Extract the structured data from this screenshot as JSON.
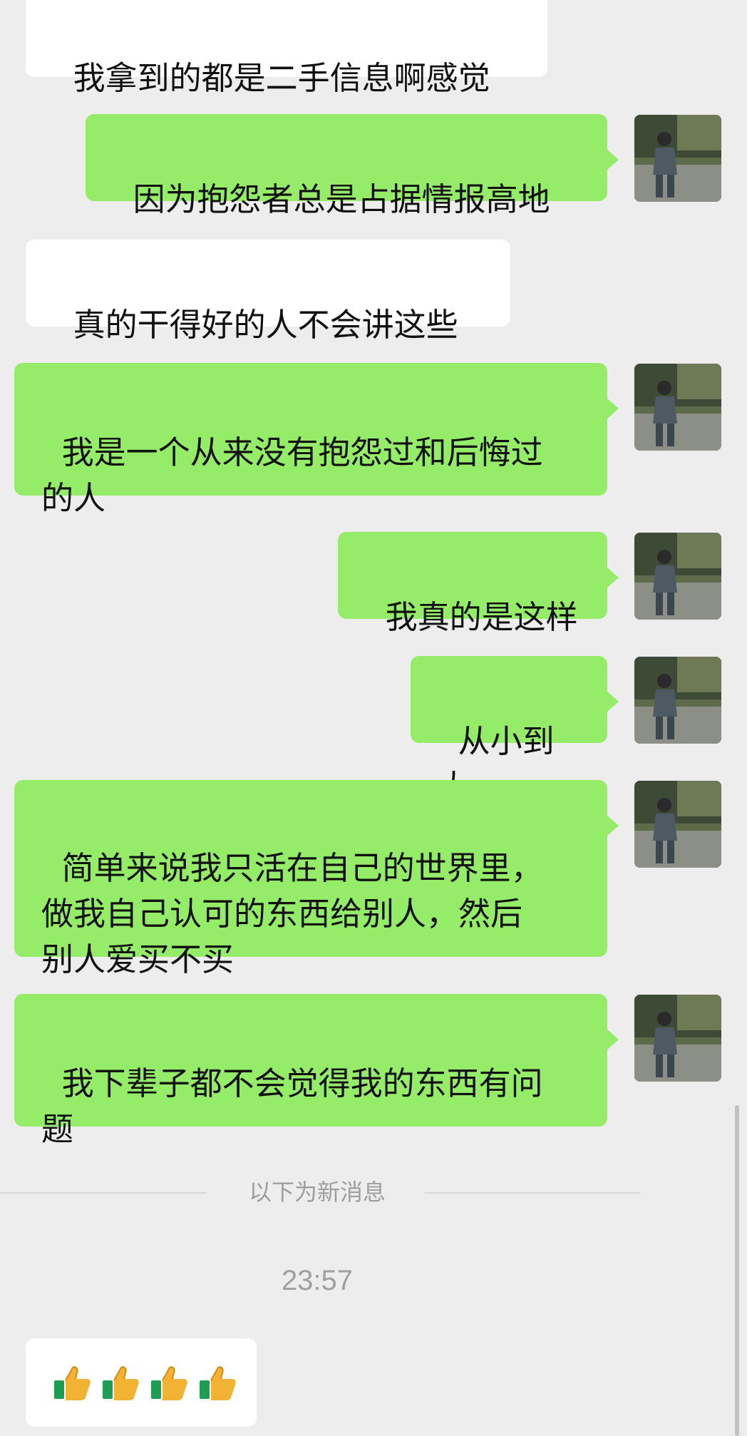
{
  "messages": [
    {
      "side": "in",
      "text": "我拿到的都是二手信息啊感觉"
    },
    {
      "side": "out",
      "text": "因为抱怨者总是占据情报高地"
    },
    {
      "side": "in",
      "text": "真的干得好的人不会讲这些"
    },
    {
      "side": "out",
      "text": "我是一个从来没有抱怨过和后悔过\n的人"
    },
    {
      "side": "out",
      "text": "我真的是这样"
    },
    {
      "side": "out",
      "text": "从小到大"
    },
    {
      "side": "out",
      "text": "简单来说我只活在自己的世界里，\n做我自己认可的东西给别人，然后\n别人爱买不买"
    },
    {
      "side": "out",
      "text": "我下辈子都不会觉得我的东西有问\n题"
    }
  ],
  "divider": {
    "label": "以下为新消息"
  },
  "timestamp": "23:57",
  "last_message": {
    "side": "in",
    "emoji": [
      "thumbs-up",
      "thumbs-up",
      "thumbs-up",
      "thumbs-up"
    ]
  }
}
